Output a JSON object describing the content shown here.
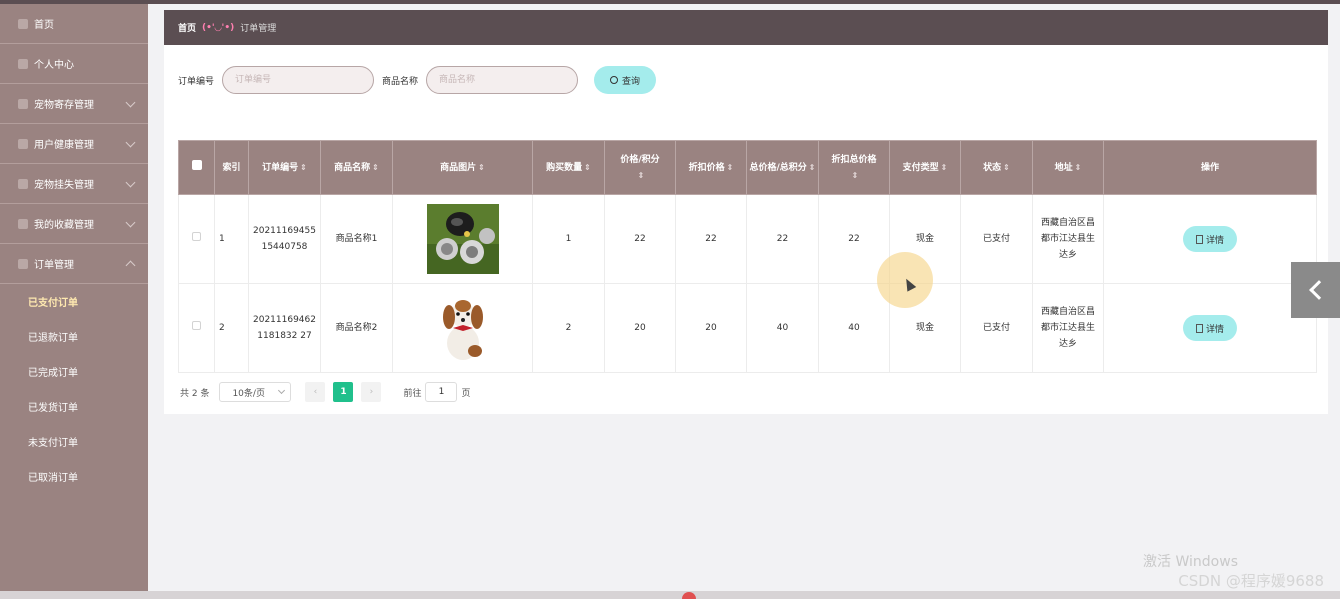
{
  "sidebar": {
    "items": [
      {
        "label": "首页",
        "icon": "home-icon"
      },
      {
        "label": "个人中心",
        "icon": "user-icon"
      },
      {
        "label": "宠物寄存管理",
        "icon": "box-icon"
      },
      {
        "label": "用户健康管理",
        "icon": "health-icon"
      },
      {
        "label": "宠物挂失管理",
        "icon": "bell-icon"
      },
      {
        "label": "我的收藏管理",
        "icon": "star-icon"
      },
      {
        "label": "订单管理",
        "icon": "grid-icon"
      }
    ],
    "sub_items": [
      {
        "label": "已支付订单",
        "active": true
      },
      {
        "label": "已退款订单",
        "active": false
      },
      {
        "label": "已完成订单",
        "active": false
      },
      {
        "label": "已发货订单",
        "active": false
      },
      {
        "label": "未支付订单",
        "active": false
      },
      {
        "label": "已取消订单",
        "active": false
      }
    ]
  },
  "breadcrumb": {
    "home": "首页",
    "emote": "(•'◡'•)",
    "current": "订单管理"
  },
  "search": {
    "order_label": "订单编号",
    "order_placeholder": "订单编号",
    "product_label": "商品名称",
    "product_placeholder": "商品名称",
    "button_label": "查询"
  },
  "table": {
    "headers": {
      "index": "索引",
      "order_no": "订单编号",
      "product_name": "商品名称",
      "product_img": "商品图片",
      "qty": "购买数量",
      "price": "价格/积分",
      "discount_price": "折扣价格",
      "total": "总价格/总积分",
      "discount_total": "折扣总价格",
      "pay_type": "支付类型",
      "status": "状态",
      "address": "地址",
      "actions": "操作"
    },
    "rows": [
      {
        "index": "1",
        "order_no": "2021116945515440758",
        "product_name": "商品名称1",
        "qty": "1",
        "price": "22",
        "discount_price": "22",
        "total": "22",
        "discount_total": "22",
        "pay_type": "现金",
        "status": "已支付",
        "address": "西藏自治区昌都市江达县生达乡",
        "action": "详情"
      },
      {
        "index": "2",
        "order_no": "202111694621181832 27",
        "product_name": "商品名称2",
        "qty": "2",
        "price": "20",
        "discount_price": "20",
        "total": "40",
        "discount_total": "40",
        "pay_type": "现金",
        "status": "已支付",
        "address": "西藏自治区昌都市江达县生达乡",
        "action": "详情"
      }
    ]
  },
  "pagination": {
    "total_text": "共 2 条",
    "page_size": "10条/页",
    "current_page": "1",
    "goto_label": "前往",
    "goto_value": "1",
    "page_suffix": "页"
  },
  "watermark": {
    "activate": "激活 Windows",
    "csdn": "CSDN @程序媛9688"
  },
  "colors": {
    "sidebar": "#9a8381",
    "header": "#5b4e52",
    "accent": "#a4ecec",
    "page_active": "#20c08c"
  }
}
